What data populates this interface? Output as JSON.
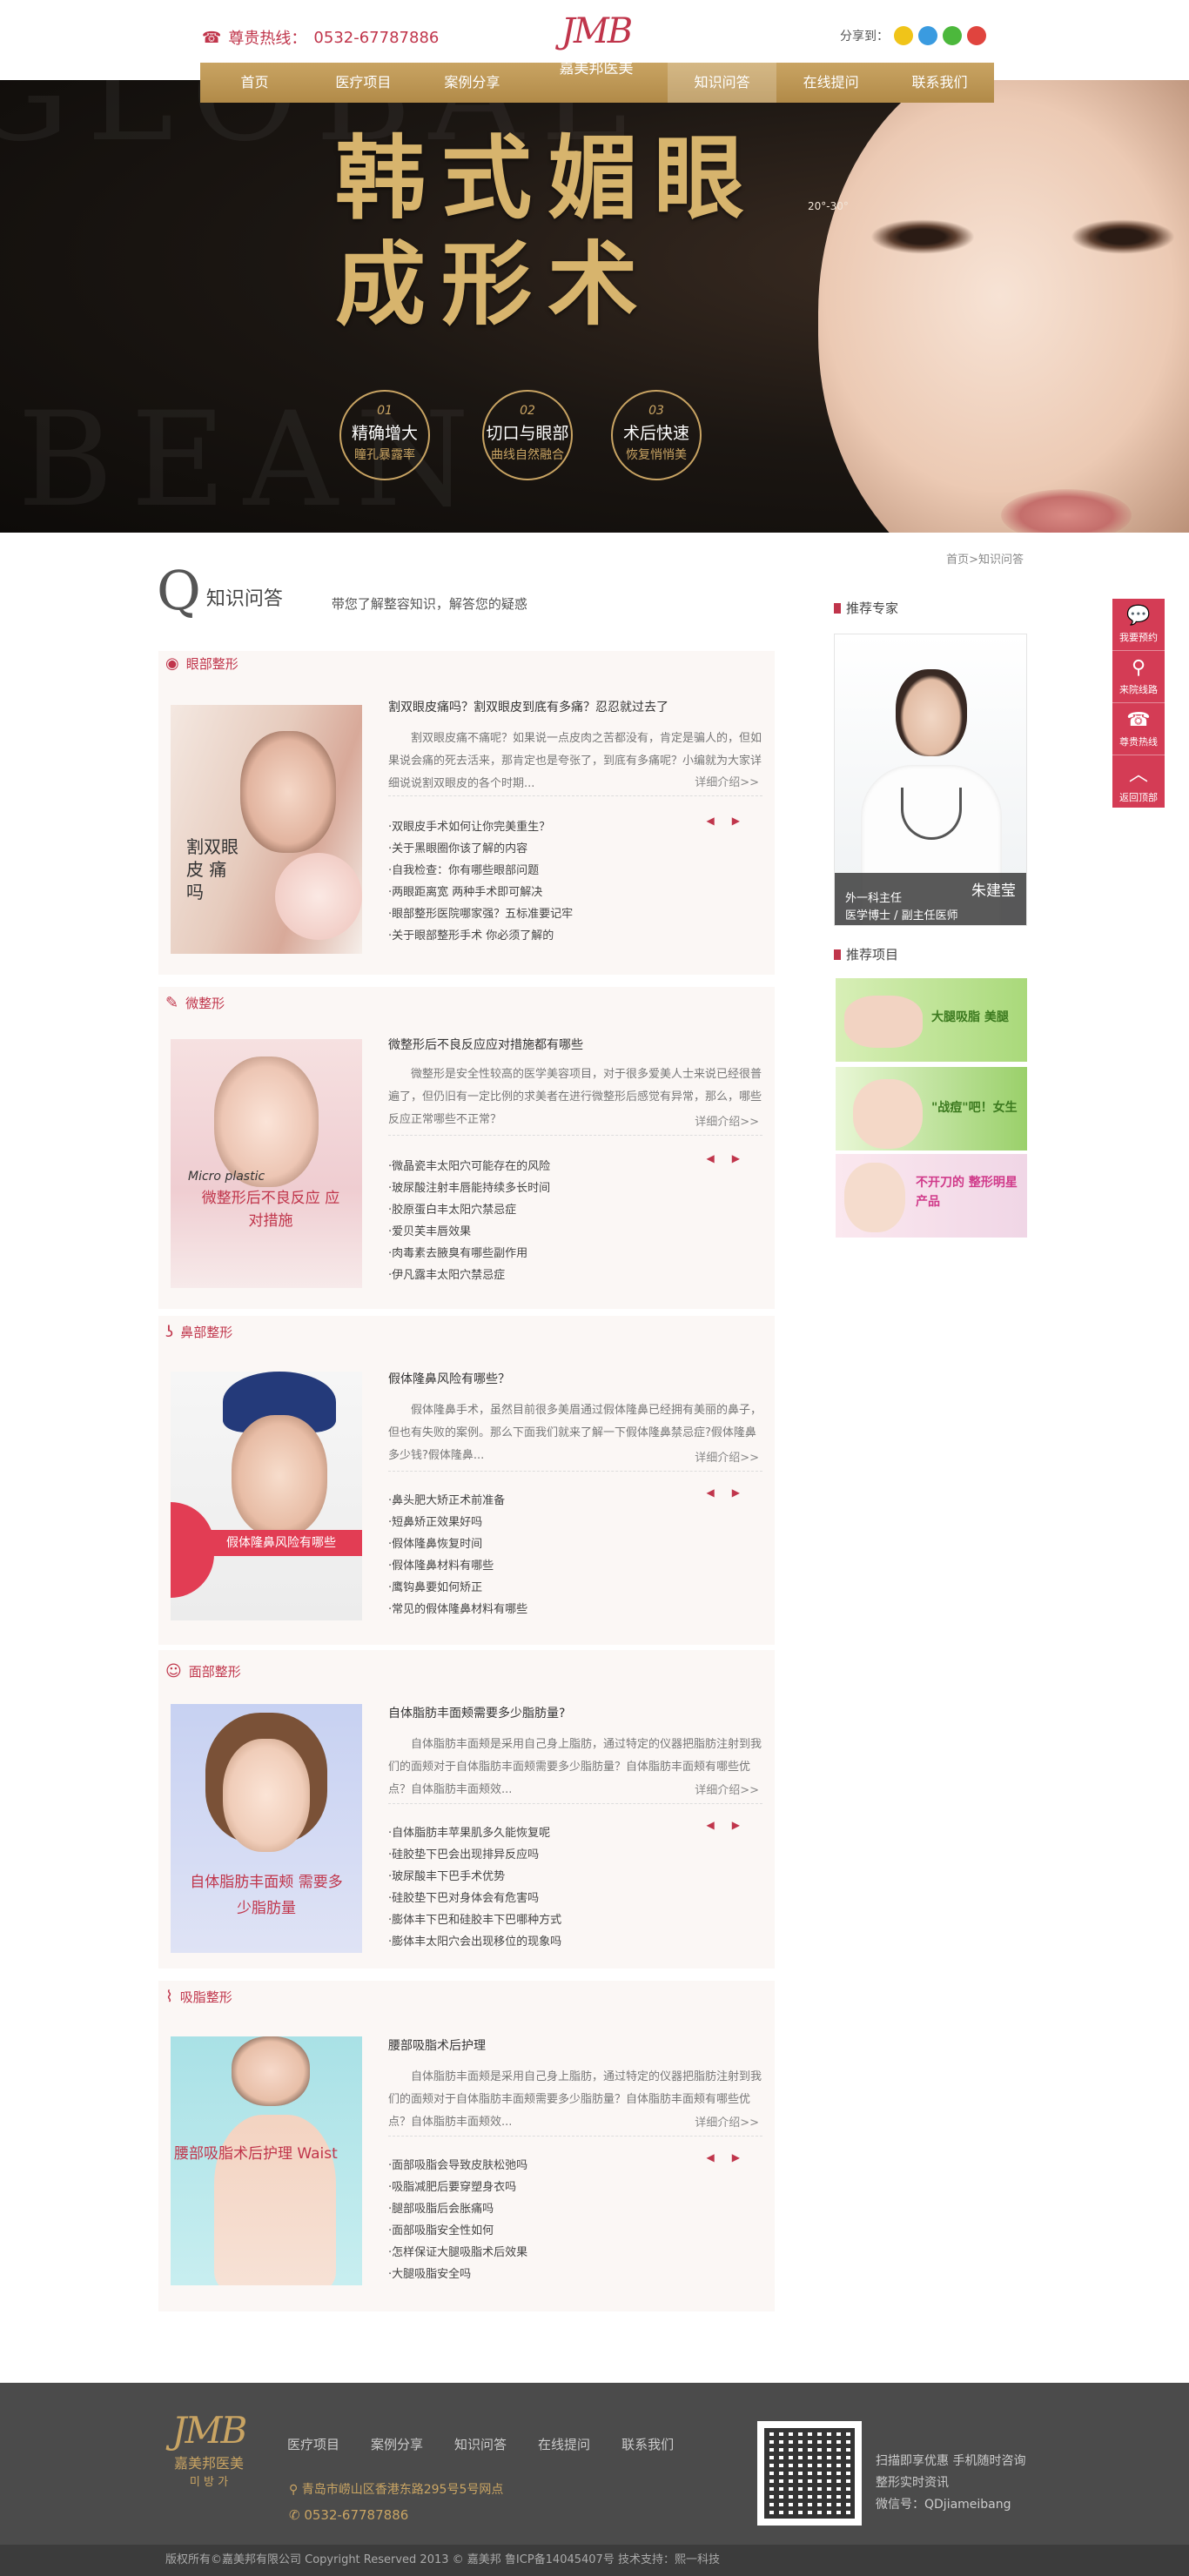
{
  "header": {
    "hotline_label": "尊贵热线：",
    "hotline_number": "0532-67787886",
    "logo_mark": "JMB",
    "logo_cn": "嘉美邦医美",
    "share_label": "分享到："
  },
  "nav": [
    "首页",
    "医疗项目",
    "案例分享",
    "",
    "知识问答",
    "在线提问",
    "联系我们"
  ],
  "banner": {
    "title_line1": "韩式媚眼",
    "title_line2": "成形术",
    "angle_label": "20°-30°",
    "badges": [
      {
        "num": "01",
        "l1": "精确增大",
        "l2": "瞳孔暴露率"
      },
      {
        "num": "02",
        "l1": "切口与眼部",
        "l2": "曲线自然融合"
      },
      {
        "num": "03",
        "l1": "术后快速",
        "l2": "恢复悄悄美"
      }
    ]
  },
  "breadcrumb": "首页>知识问答",
  "section": {
    "q": "Q",
    "title": "知识问答",
    "subtitle": "带您了解整容知识，解答您的疑惑"
  },
  "categories": [
    {
      "name": "眼部整形",
      "photo_caption": "割双眼皮 痛吗",
      "q_title": "割双眼皮痛吗？割双眼皮到底有多痛？忍忍就过去了",
      "q_body": "割双眼皮痛不痛呢？如果说一点皮肉之苦都没有，肯定是骗人的，但如果说会痛的死去活来，那肯定也是夸张了，到底有多痛呢？小编就为大家详细说说割双眼皮的各个时期...",
      "more": "详细介绍>>",
      "links": [
        "·双眼皮手术如何让你完美重生？",
        "·关于黑眼圈你该了解的内容",
        "·自我检查：你有哪些眼部问题",
        "·两眼距离宽 两种手术即可解决",
        "·眼部整形医院哪家强？五标准要记牢",
        "·关于眼部整形手术 你必须了解的"
      ]
    },
    {
      "name": "微整形",
      "photo_caption": "微整形后不良反应 应对措施",
      "q_title": "微整形后不良反应应对措施都有哪些",
      "q_body": "微整形是安全性较高的医学美容项目，对于很多爱美人士来说已经很普遍了，但仍旧有一定比例的求美者在进行微整形后感觉有异常，那么，哪些反应正常哪些不正常？",
      "more": "详细介绍>>",
      "links": [
        "·微晶瓷丰太阳穴可能存在的风险",
        "·玻尿酸注射丰唇能持续多长时间",
        "·胶原蛋白丰太阳穴禁忌症",
        "·爱贝芙丰唇效果",
        "·肉毒素去腋臭有哪些副作用",
        "·伊凡露丰太阳穴禁忌症"
      ]
    },
    {
      "name": "鼻部整形",
      "photo_caption": "假体隆鼻风险有哪些",
      "q_title": "假体隆鼻风险有哪些？",
      "q_body": "假体隆鼻手术，虽然目前很多美眉通过假体隆鼻已经拥有美丽的鼻子，但也有失败的案例。那么下面我们就来了解一下假体隆鼻禁忌症?假体隆鼻多少钱?假体隆鼻...",
      "more": "详细介绍>>",
      "links": [
        "·鼻头肥大矫正术前准备",
        "·短鼻矫正效果好吗",
        "·假体隆鼻恢复时间",
        "·假体隆鼻材料有哪些",
        "·鹰钩鼻要如何矫正",
        "·常见的假体隆鼻材料有哪些"
      ]
    },
    {
      "name": "面部整形",
      "photo_caption": "自体脂肪丰面颊 需要多少脂肪量",
      "q_title": "自体脂肪丰面颊需要多少脂肪量?",
      "q_body": "自体脂肪丰面颊是采用自己身上脂肪，通过特定的仪器把脂肪注射到我们的面颊对于自体脂肪丰面颊需要多少脂肪量？自体脂肪丰面颊有哪些优点？自体脂肪丰面颊效...",
      "more": "详细介绍>>",
      "links": [
        "·自体脂肪丰苹果肌多久能恢复呢",
        "·硅胶垫下巴会出现排异反应吗",
        "·玻尿酸丰下巴手术优势",
        "·硅胶垫下巴对身体会有危害吗",
        "·膨体丰下巴和硅胶丰下巴哪种方式",
        "·膨体丰太阳穴会出现移位的现象吗"
      ]
    },
    {
      "name": "吸脂整形",
      "photo_caption": "腰部吸脂术后护理 Waist",
      "q_title": "腰部吸脂术后护理",
      "q_body": "自体脂肪丰面颊是采用自己身上脂肪，通过特定的仪器把脂肪注射到我们的面颊对于自体脂肪丰面颊需要多少脂肪量？自体脂肪丰面颊有哪些优点？自体脂肪丰面颊效...",
      "more": "详细介绍>>",
      "links": [
        "·面部吸脂会导致皮肤松弛吗",
        "·吸脂减肥后要穿塑身衣吗",
        "·腿部吸脂后会胀痛吗",
        "·面部吸脂安全性如何",
        "·怎样保证大腿吸脂术后效果",
        "·大腿吸脂安全吗"
      ]
    }
  ],
  "sidebar": {
    "expert_title": "推荐专家",
    "expert": {
      "name": "朱建莹",
      "role": "外一科主任",
      "degree": "医学博士 / 副主任医师"
    },
    "projects_title": "推荐项目",
    "projects": [
      "大腿吸脂 美腿",
      "\"战痘\"吧！女生",
      "不开刀的 整形明星产品"
    ]
  },
  "float_bar": [
    "我要预约",
    "来院线路",
    "尊贵热线",
    "返回顶部"
  ],
  "footer": {
    "logo_mark": "JMB",
    "logo_cn": "嘉美邦医美",
    "logo_kr": "미 방 가",
    "nav": [
      "医疗项目",
      "案例分享",
      "知识问答",
      "在线提问",
      "联系我们"
    ],
    "address": "青岛市崂山区香港东路295号5号网点",
    "phone": "0532-67787886",
    "qr_lines": [
      "扫描即享优惠 手机随时咨询",
      "整形实时资讯",
      "微信号：QDjiameibang"
    ],
    "copyright": "版权所有©嘉美邦有限公司    Copyright Reserved 2013 © 嘉美邦    鲁ICP备14045407号    技术支持：熙一科技"
  },
  "colors": {
    "accent": "#c0354b",
    "gold": "#c9a463",
    "footer_bg": "#4b4b4b"
  }
}
